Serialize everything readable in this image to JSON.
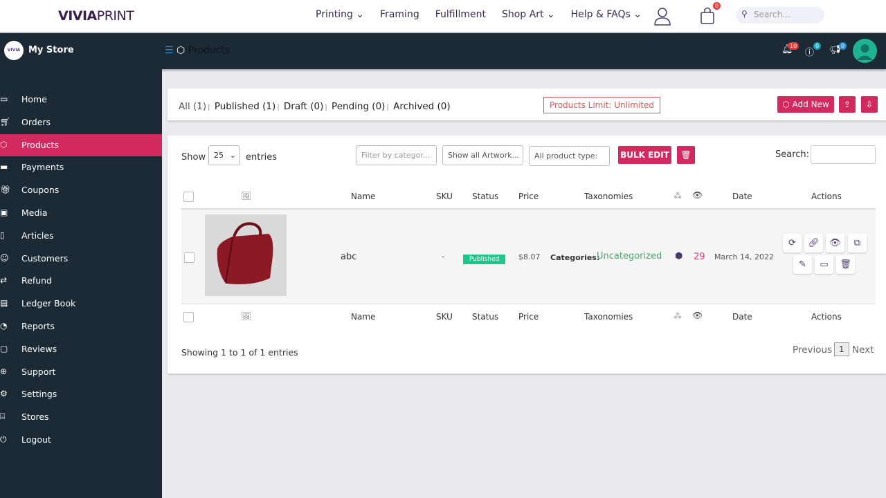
{
  "topnav": {
    "logo_bold": "VIVIA",
    "logo_light": "PRINT",
    "links": [
      "Printing",
      "Framing",
      "Fulfillment",
      "Shop Art",
      "Help & FAQs"
    ],
    "cart_count": "0",
    "search_placeholder": "Search..."
  },
  "header": {
    "store_logo": "VIVIA",
    "store_name": "My Store",
    "breadcrumb": "Products",
    "notifications": "10",
    "help": "0",
    "announcements": "0"
  },
  "sidebar": {
    "items": [
      {
        "label": "Home",
        "icon": "home-icon"
      },
      {
        "label": "Orders",
        "icon": "cart-icon"
      },
      {
        "label": "Products",
        "icon": "cube-icon"
      },
      {
        "label": "Payments",
        "icon": "credit-card-icon"
      },
      {
        "label": "Coupons",
        "icon": "gift-icon"
      },
      {
        "label": "Media",
        "icon": "image-icon"
      },
      {
        "label": "Articles",
        "icon": "file-icon"
      },
      {
        "label": "Customers",
        "icon": "user-circle-icon"
      },
      {
        "label": "Refund",
        "icon": "retweet-icon"
      },
      {
        "label": "Ledger Book",
        "icon": "money-icon"
      },
      {
        "label": "Reports",
        "icon": "pie-chart-icon"
      },
      {
        "label": "Reviews",
        "icon": "comment-icon"
      },
      {
        "label": "Support",
        "icon": "lifebuoy-icon"
      },
      {
        "label": "Settings",
        "icon": "cogs-icon"
      },
      {
        "label": "Stores",
        "icon": "store-icon"
      },
      {
        "label": "Logout",
        "icon": "power-icon"
      }
    ],
    "active": "Products"
  },
  "filters": {
    "all": "All (1)",
    "published": "Published (1)",
    "draft": "Draft (0)",
    "pending": "Pending (0)",
    "archived": "Archived (0)"
  },
  "limit": "Products Limit: Unlimited",
  "add_new": "Add New",
  "table": {
    "show_label": "Show",
    "entries_value": "25",
    "entries_label": "entries",
    "category_filter": "Filter by categor...",
    "artwork_filter": "Show all Artwork...",
    "type_filter": "All product type:",
    "bulk_edit": "BULK EDIT",
    "search_label": "Search:",
    "headers": {
      "name": "Name",
      "sku": "SKU",
      "status": "Status",
      "price": "Price",
      "taxonomies": "Taxonomies",
      "date": "Date",
      "actions": "Actions"
    },
    "rows": [
      {
        "name": "abc",
        "sku": "-",
        "status": "Published",
        "price": "$8.07",
        "tax_label": "Categories:",
        "tax_value": "Uncategorized",
        "views": "29",
        "date": "March 14, 2022"
      }
    ],
    "info": "Showing 1 to 1 of 1 entries",
    "prev": "Previous",
    "page": "1",
    "next": "Next"
  },
  "colors": {
    "accent": "#d2295e",
    "dark": "#1c2a35",
    "published": "#1fc68a"
  }
}
